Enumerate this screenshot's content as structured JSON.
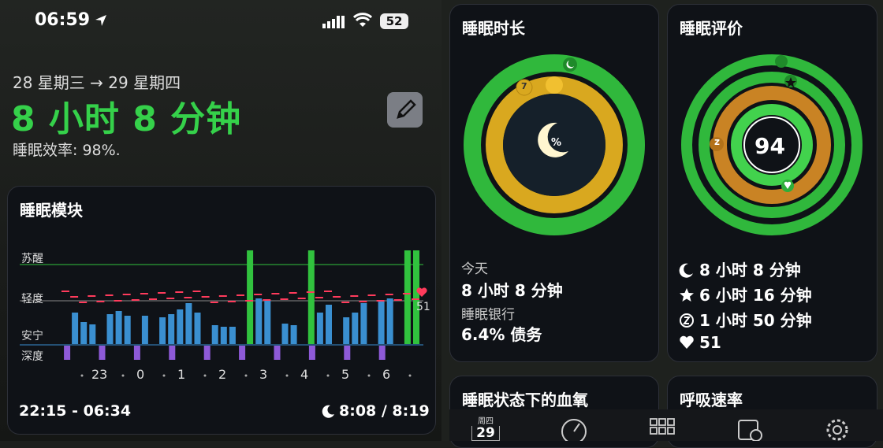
{
  "status_bar": {
    "time": "06:59",
    "battery": "52"
  },
  "summary": {
    "date_range": "28 星期三 → 29 星期四",
    "duration": "8 小时 8 分钟",
    "efficiency": "睡眠效率: 98%."
  },
  "sleep_chart": {
    "title": "睡眠模块",
    "stage_labels": [
      "苏醒",
      "轻度",
      "安宁",
      "深度"
    ],
    "hour_labels": [
      "23",
      "0",
      "1",
      "2",
      "3",
      "4",
      "5",
      "6"
    ],
    "time_range": "22:15 - 06:34",
    "asleep": "8:08 / 8:19",
    "heart_rate": "51"
  },
  "chart_data": {
    "type": "bar",
    "x_labels": [
      "23",
      "0",
      "1",
      "2",
      "3",
      "4",
      "5",
      "6"
    ],
    "y_categories": [
      "苏醒",
      "轻度",
      "安宁",
      "深度"
    ],
    "colors": {
      "awake": "#31c23e",
      "restful": "#3a8fd0",
      "deep": "#8e5ad8",
      "hr": "#ff3b5c"
    }
  },
  "duration_card": {
    "title": "睡眠时长",
    "today_label": "今天",
    "today_value": "8 小时 8 分钟",
    "bank_label": "睡眠银行",
    "bank_value": "6.4% 债务",
    "ring_badge": "7",
    "center_label": "%"
  },
  "score_card": {
    "title": "睡眠评价",
    "score": "94",
    "badge": "z",
    "stats": [
      "8 小时 8 分钟",
      "6 小时 16 分钟",
      "1 小时 50 分钟",
      "51"
    ]
  },
  "o2_card": {
    "title": "睡眠状态下的血氧"
  },
  "resp_card": {
    "title": "呼吸速率"
  },
  "tabbar": {
    "day_name": "周四",
    "day_num": "29"
  }
}
